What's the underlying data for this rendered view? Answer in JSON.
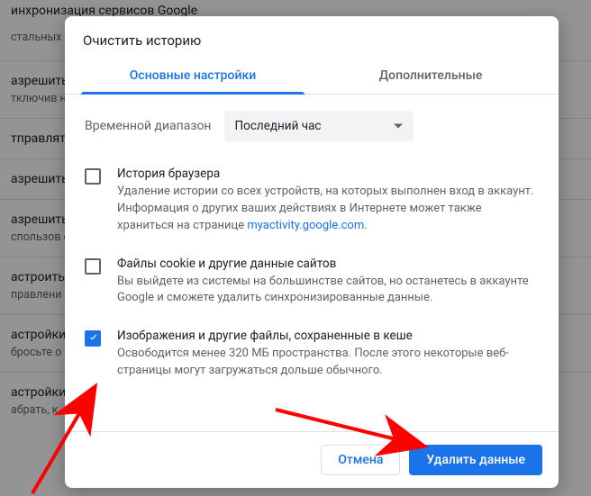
{
  "background": {
    "header": "инхронизация сервисов Google",
    "header_sub": "стальных",
    "rows": [
      {
        "t": "азрешить",
        "s": "тключив необходи"
      },
      {
        "t": "тправлят",
        "s": ""
      },
      {
        "t": "азрешить",
        "s": ""
      },
      {
        "t": "азрешить",
        "s": "спользов скрывает"
      },
      {
        "t": "астроить",
        "s": "правлени"
      },
      {
        "t": "астройки",
        "s": "бросьте о"
      },
      {
        "t": "астройки",
        "s": "абрать, к"
      }
    ]
  },
  "dialog": {
    "title": "Очистить историю",
    "tabs": {
      "basic": "Основные настройки",
      "advanced": "Дополнительные"
    },
    "time_range": {
      "label": "Временной диапазон",
      "value": "Последний час"
    },
    "options": [
      {
        "checked": false,
        "title": "История браузера",
        "desc_before": "Удаление истории со всех устройств, на которых выполнен вход в аккаунт. Информация о других ваших действиях в Интернете может также храниться на странице ",
        "link_text": "myactivity.google.com",
        "desc_after": "."
      },
      {
        "checked": false,
        "title": "Файлы cookie и другие данные сайтов",
        "desc_before": "Вы выйдете из системы на большинстве сайтов, но останетесь в аккаунте Google и сможете удалить синхронизированные данные.",
        "link_text": "",
        "desc_after": ""
      },
      {
        "checked": true,
        "title": "Изображения и другие файлы, сохраненные в кеше",
        "desc_before": "Освободится менее 320 МБ пространства. После этого некоторые веб-страницы могут загружаться дольше обычного.",
        "link_text": "",
        "desc_after": ""
      }
    ],
    "buttons": {
      "cancel": "Отмена",
      "confirm": "Удалить данные"
    }
  }
}
